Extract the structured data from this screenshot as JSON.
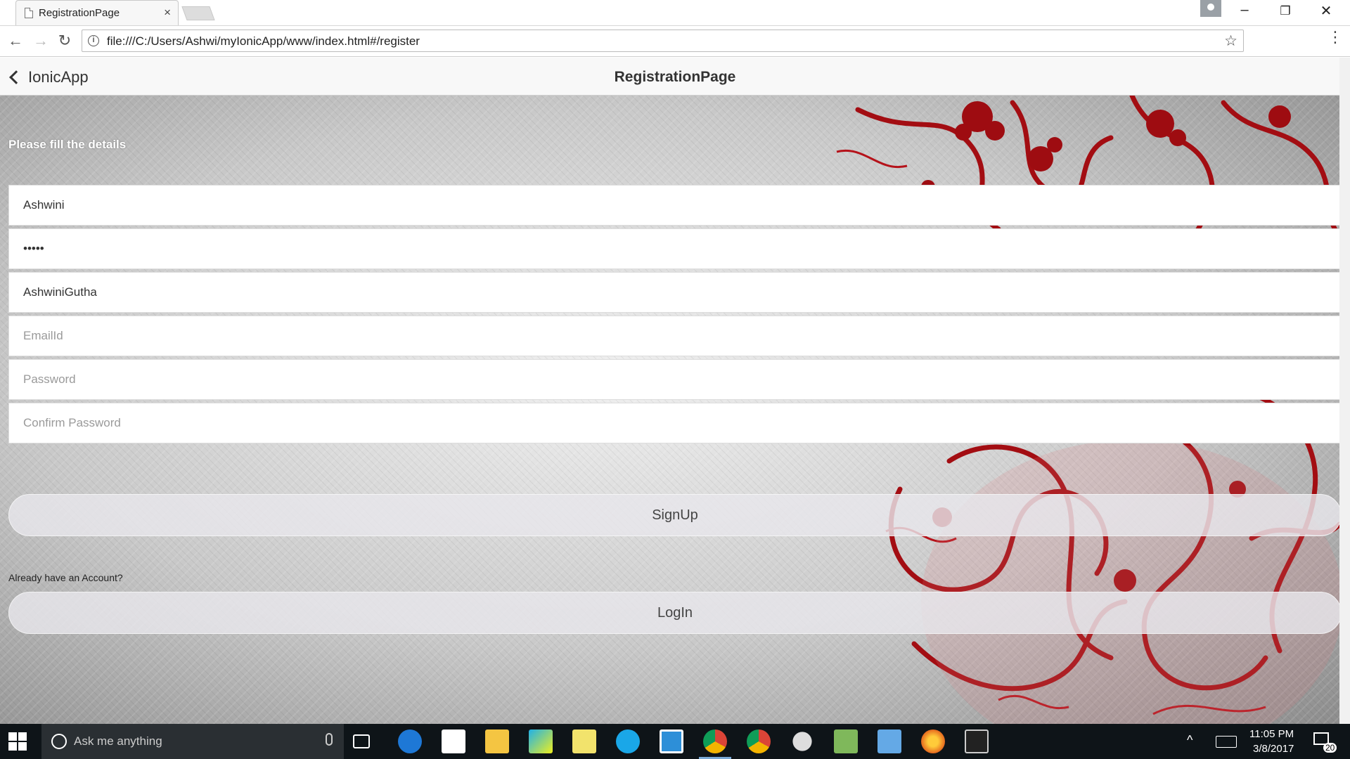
{
  "browser": {
    "tab_title": "RegistrationPage",
    "tab_close": "×",
    "url": "file:///C:/Users/Ashwi/myIonicApp/www/index.html#/register",
    "window_minimize": "–",
    "window_restore": "❐",
    "window_close": "✕",
    "nav_back": "←",
    "nav_forward": "→",
    "nav_reload": "↻",
    "info": "i",
    "star": "☆",
    "menu": "⋮"
  },
  "app": {
    "back_label": "IonicApp",
    "title": "RegistrationPage",
    "instruction": "Please fill the details",
    "fields": [
      {
        "name": "first-name",
        "value": "Ashwini",
        "placeholder": "",
        "type": "text"
      },
      {
        "name": "password-short",
        "value": "•••••",
        "placeholder": "",
        "type": "text"
      },
      {
        "name": "username",
        "value": "AshwiniGutha",
        "placeholder": "",
        "type": "text"
      },
      {
        "name": "emailid",
        "value": "",
        "placeholder": "EmailId",
        "type": "text"
      },
      {
        "name": "password",
        "value": "",
        "placeholder": "Password",
        "type": "password"
      },
      {
        "name": "confirm-password",
        "value": "",
        "placeholder": "Confirm Password",
        "type": "password"
      }
    ],
    "signup_label": "SignUp",
    "already_text": "Already have an Account?",
    "login_label": "LogIn"
  },
  "taskbar": {
    "search_placeholder": "Ask me anything",
    "time": "11:05 PM",
    "date": "3/8/2017",
    "notifications": "20",
    "apps": [
      "task-view",
      "edge",
      "store",
      "file-explorer",
      "webstorm",
      "sticky-notes",
      "skype",
      "terminal",
      "chrome",
      "chrome",
      "settings",
      "notepad",
      "control-panel",
      "firefox",
      "cmd"
    ]
  },
  "colors": {
    "accent_red": "#a30d12",
    "taskbar": "#0e1418"
  }
}
